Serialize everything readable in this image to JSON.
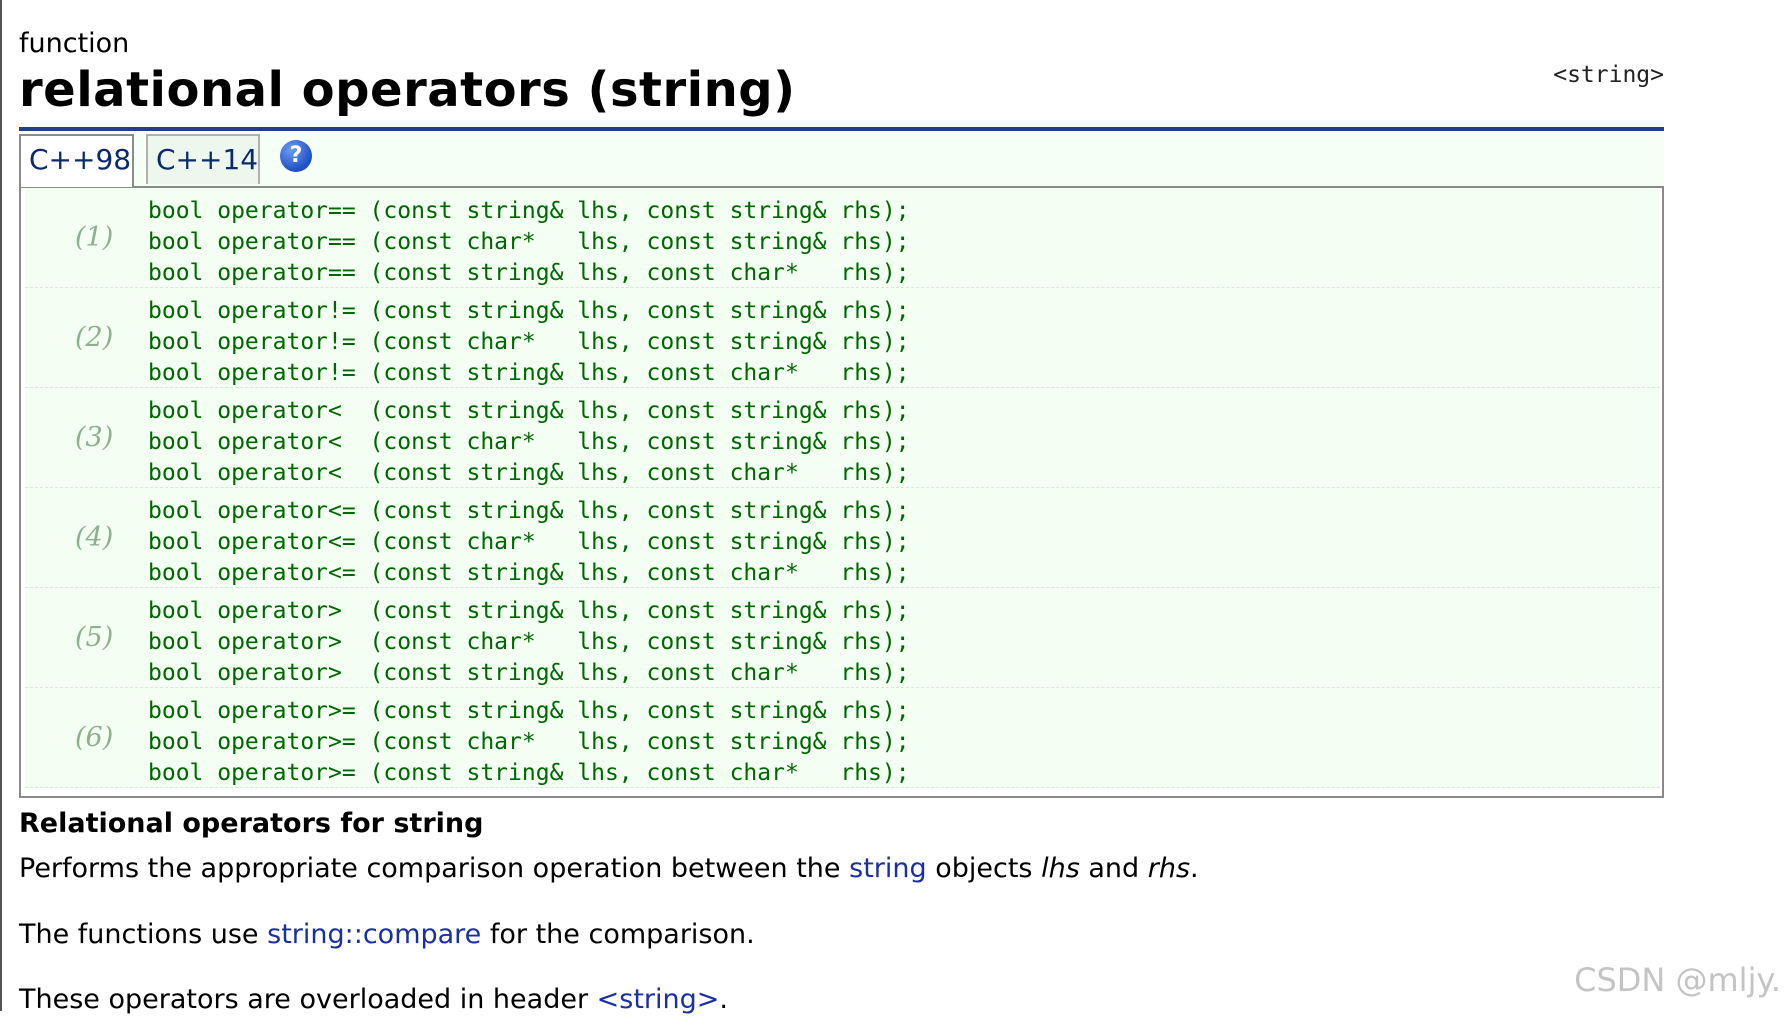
{
  "header": {
    "kind": "function",
    "title": "relational operators (string)",
    "header_tag": "<string>"
  },
  "tabs": [
    {
      "label": "C++98",
      "active": true
    },
    {
      "label": "C++14",
      "active": false
    }
  ],
  "help_icon": {
    "glyph": "?",
    "icon": "help-icon"
  },
  "prototypes": [
    {
      "number": "(1)",
      "lines": [
        "bool operator== (const string& lhs, const string& rhs);",
        "bool operator== (const char*   lhs, const string& rhs);",
        "bool operator== (const string& lhs, const char*   rhs);"
      ]
    },
    {
      "number": "(2)",
      "lines": [
        "bool operator!= (const string& lhs, const string& rhs);",
        "bool operator!= (const char*   lhs, const string& rhs);",
        "bool operator!= (const string& lhs, const char*   rhs);"
      ]
    },
    {
      "number": "(3)",
      "lines": [
        "bool operator<  (const string& lhs, const string& rhs);",
        "bool operator<  (const char*   lhs, const string& rhs);",
        "bool operator<  (const string& lhs, const char*   rhs);"
      ]
    },
    {
      "number": "(4)",
      "lines": [
        "bool operator<= (const string& lhs, const string& rhs);",
        "bool operator<= (const char*   lhs, const string& rhs);",
        "bool operator<= (const string& lhs, const char*   rhs);"
      ]
    },
    {
      "number": "(5)",
      "lines": [
        "bool operator>  (const string& lhs, const string& rhs);",
        "bool operator>  (const char*   lhs, const string& rhs);",
        "bool operator>  (const string& lhs, const char*   rhs);"
      ]
    },
    {
      "number": "(6)",
      "lines": [
        "bool operator>= (const string& lhs, const string& rhs);",
        "bool operator>= (const char*   lhs, const string& rhs);",
        "bool operator>= (const string& lhs, const char*   rhs);"
      ]
    }
  ],
  "description": {
    "section_title": "Relational operators for string",
    "p1": {
      "pre": "Performs the appropriate comparison operation between the ",
      "link": "string",
      "mid": " objects ",
      "lhs": "lhs",
      "and": " and ",
      "rhs": "rhs",
      "end": "."
    },
    "p2": {
      "pre": "The functions use ",
      "link": "string::compare",
      "end": " for the comparison."
    },
    "p3": {
      "pre": "These operators are overloaded in header ",
      "link": "<string>",
      "end": "."
    }
  },
  "watermark": "CSDN @mljy.",
  "colors": {
    "title_rule": "#1f3f86",
    "code_text": "#006600",
    "proto_bg": "#f3fff3",
    "link": "#1a2fa0",
    "number": "#8fb08f"
  }
}
